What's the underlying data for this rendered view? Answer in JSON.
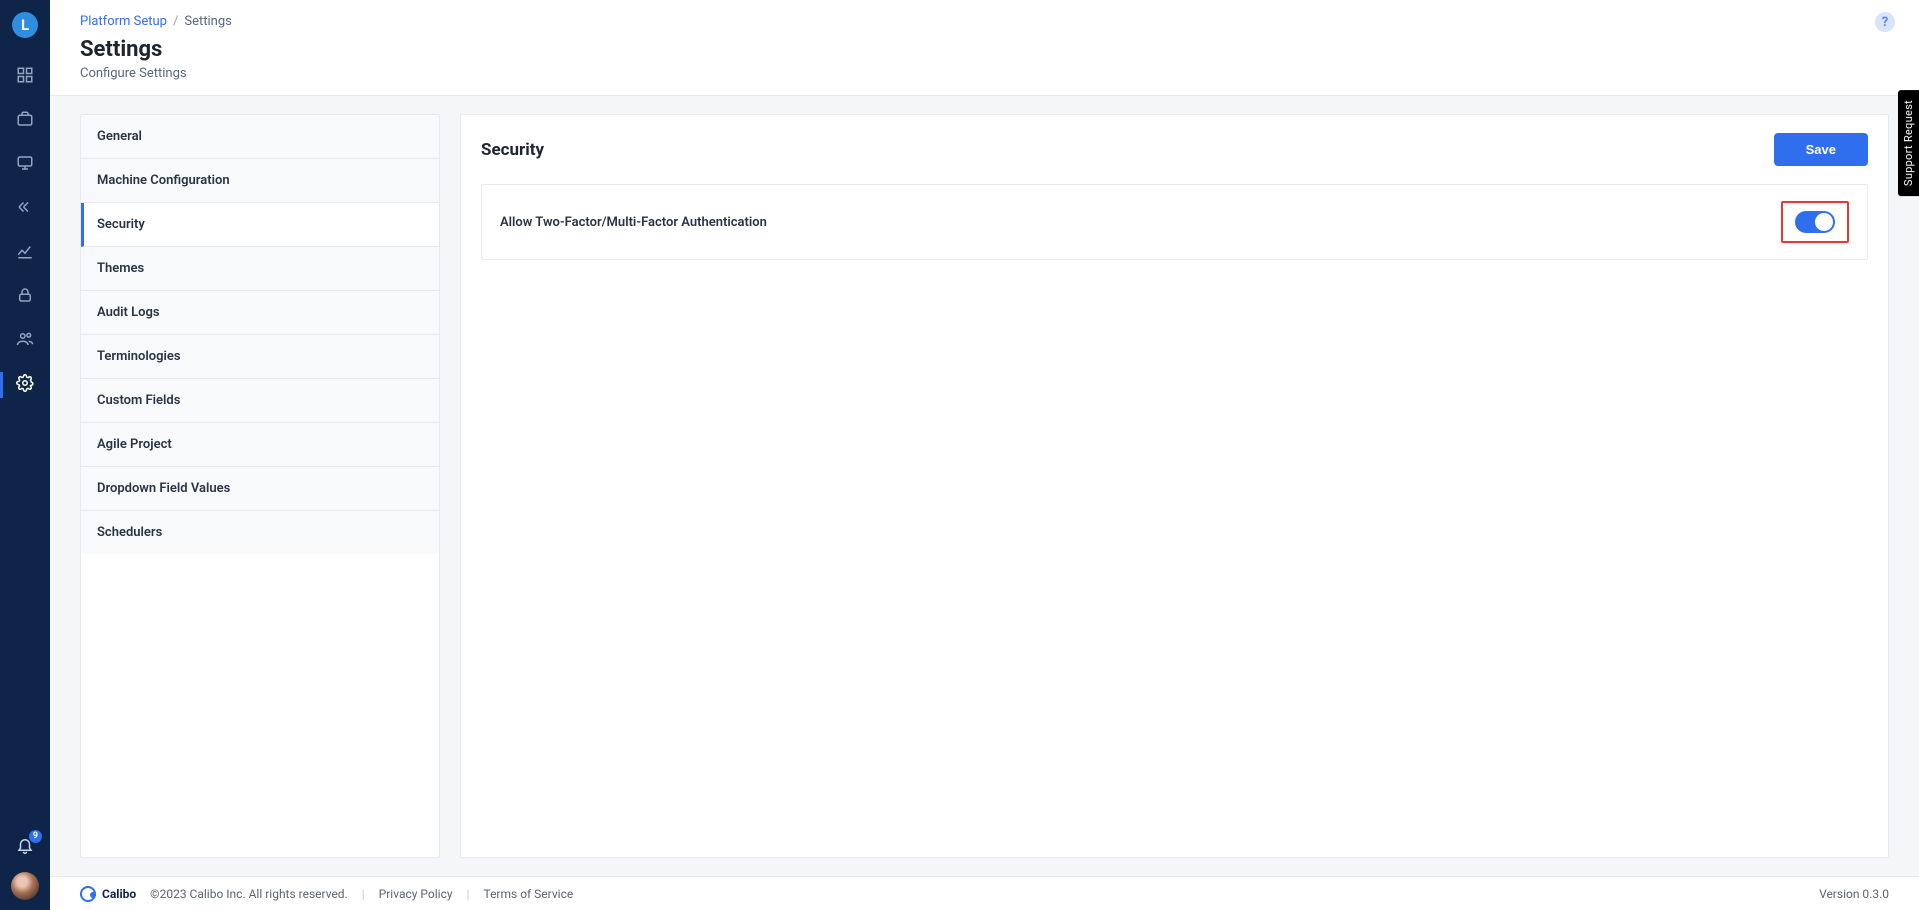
{
  "logo_letter": "L",
  "breadcrumb": {
    "parent": "Platform Setup",
    "sep": "/",
    "current": "Settings"
  },
  "page": {
    "title": "Settings",
    "subtitle": "Configure Settings"
  },
  "settings_nav": {
    "items": [
      {
        "label": "General"
      },
      {
        "label": "Machine Configuration"
      },
      {
        "label": "Security"
      },
      {
        "label": "Themes"
      },
      {
        "label": "Audit Logs"
      },
      {
        "label": "Terminologies"
      },
      {
        "label": "Custom Fields"
      },
      {
        "label": "Agile Project"
      },
      {
        "label": "Dropdown Field Values"
      },
      {
        "label": "Schedulers"
      }
    ]
  },
  "panel": {
    "title": "Security",
    "save_label": "Save",
    "mfa_label": "Allow Two-Factor/Multi-Factor Authentication"
  },
  "notifications": {
    "count": "9"
  },
  "support_tab": "Support Request",
  "footer": {
    "brand": "Calibo",
    "copyright": "©2023 Calibo Inc. All rights reserved.",
    "privacy": "Privacy Policy",
    "terms": "Terms of Service",
    "version": "Version 0.3.0"
  }
}
